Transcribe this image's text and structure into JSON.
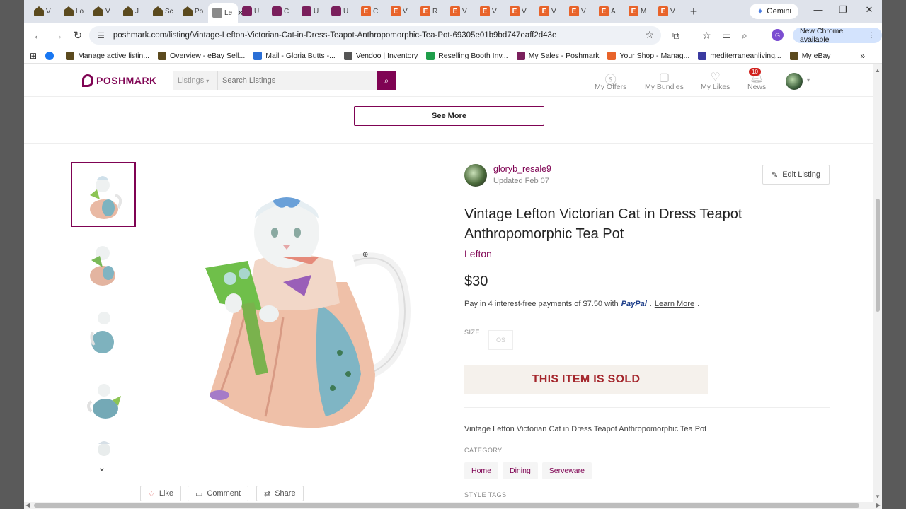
{
  "browser": {
    "tabs": [
      {
        "label": "V",
        "icon": "house"
      },
      {
        "label": "Lo",
        "icon": "house"
      },
      {
        "label": "V",
        "icon": "house"
      },
      {
        "label": "J",
        "icon": "house"
      },
      {
        "label": "Sc",
        "icon": "house"
      },
      {
        "label": "Po",
        "icon": "house"
      },
      {
        "label": "Le",
        "icon": "gray",
        "active": true
      },
      {
        "label": "U",
        "icon": "posh"
      },
      {
        "label": "C",
        "icon": "posh"
      },
      {
        "label": "U",
        "icon": "posh"
      },
      {
        "label": "U",
        "icon": "posh"
      },
      {
        "label": "C",
        "icon": "etsy"
      },
      {
        "label": "V",
        "icon": "etsy"
      },
      {
        "label": "R",
        "icon": "etsy"
      },
      {
        "label": "V",
        "icon": "etsy"
      },
      {
        "label": "V",
        "icon": "etsy"
      },
      {
        "label": "V",
        "icon": "etsy"
      },
      {
        "label": "V",
        "icon": "etsy"
      },
      {
        "label": "V",
        "icon": "etsy"
      },
      {
        "label": "A",
        "icon": "etsy"
      },
      {
        "label": "M",
        "icon": "etsy"
      },
      {
        "label": "V",
        "icon": "etsy"
      }
    ],
    "gemini_label": "Gemini",
    "url": "poshmark.com/listing/Vintage-Lefton-Victorian-Cat-in-Dress-Teapot-Anthropomorphic-Tea-Pot-69305e01b9bd747eaff2d43e",
    "new_chrome_label": "New Chrome available",
    "profile_initial": "G",
    "bookmarks": [
      {
        "label": "",
        "color": "#1877f2"
      },
      {
        "label": "Manage active listin...",
        "color": "#5b4a1e"
      },
      {
        "label": "Overview - eBay Sell...",
        "color": "#5b4a1e"
      },
      {
        "label": "Mail - Gloria Butts -...",
        "color": "#2a6fd6"
      },
      {
        "label": "Vendoo | Inventory",
        "color": "#555555"
      },
      {
        "label": "Reselling Booth Inv...",
        "color": "#1e9e4a"
      },
      {
        "label": "My Sales - Poshmark",
        "color": "#7a1f5c"
      },
      {
        "label": "Your Shop - Manag...",
        "color": "#e8632a"
      },
      {
        "label": "mediterraneanliving...",
        "color": "#3a3aa0"
      },
      {
        "label": "My eBay",
        "color": "#5b4a1e"
      }
    ]
  },
  "header": {
    "logo": "POSHMARK",
    "search_category": "Listings",
    "search_placeholder": "Search Listings",
    "nav": [
      {
        "label": "My Offers",
        "icon": "offers-icon"
      },
      {
        "label": "My Bundles",
        "icon": "bundle-icon"
      },
      {
        "label": "My Likes",
        "icon": "heart-icon"
      },
      {
        "label": "News",
        "icon": "bell-icon"
      }
    ],
    "news_badge": "10"
  },
  "see_more_label": "See More",
  "listing": {
    "seller": "gloryb_resale9",
    "updated": "Updated Feb 07",
    "edit_label": "Edit Listing",
    "title": "Vintage Lefton Victorian Cat in Dress Teapot Anthropomorphic Tea Pot",
    "brand": "Lefton",
    "price": "$30",
    "paypal_text": "Pay in 4 interest-free payments of $7.50 with",
    "paypal_brand": "PayPal",
    "learn_more": "Learn More",
    "size_label": "SIZE",
    "size_value": "OS",
    "sold_label": "THIS ITEM IS SOLD",
    "description": "Vintage Lefton Victorian Cat in Dress Teapot Anthropomorphic Tea Pot",
    "category_label": "CATEGORY",
    "categories": [
      "Home",
      "Dining",
      "Serveware"
    ],
    "style_tags_label": "STYLE TAGS"
  },
  "social": {
    "like": "Like",
    "comment": "Comment",
    "share": "Share"
  },
  "colors": {
    "brand": "#7f0353",
    "sold_text": "#a4262c",
    "sold_bg": "#f5f1ec"
  }
}
